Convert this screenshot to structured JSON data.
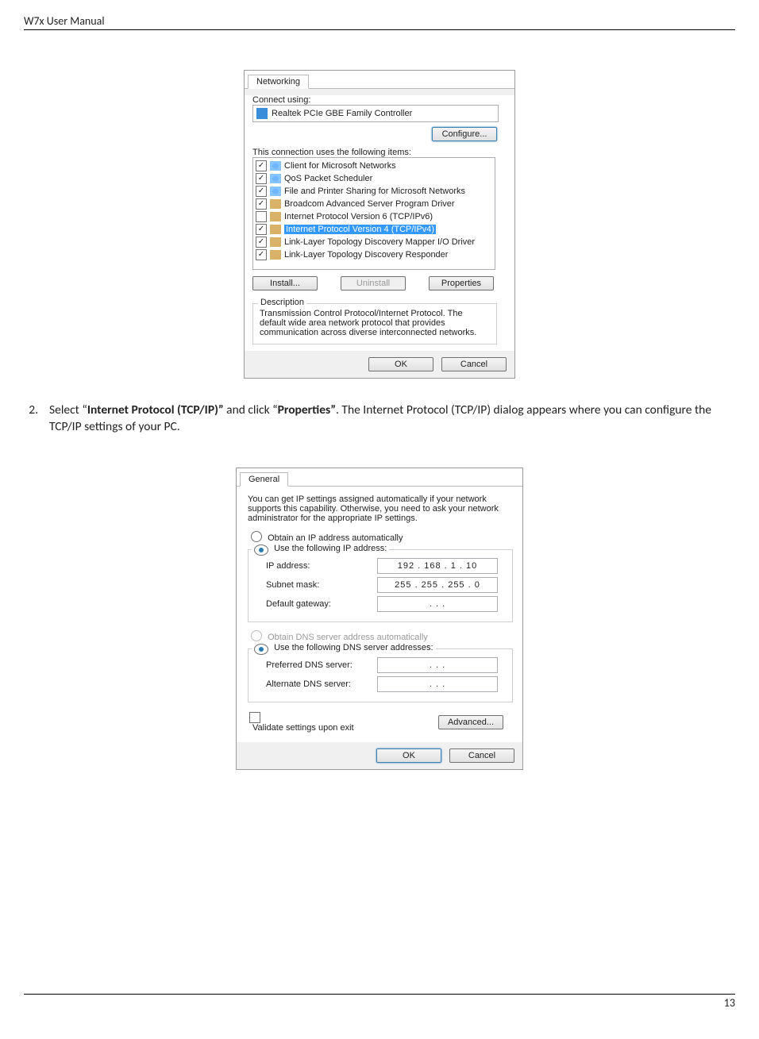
{
  "header": {
    "title": "W7x User Manual"
  },
  "footer": {
    "page_number": "13"
  },
  "figure1": {
    "tab": "Networking",
    "connect_using_label": "Connect using:",
    "adapter": "Realtek PCIe GBE Family Controller",
    "configure_btn": "Configure...",
    "uses_label": "This connection uses the following items:",
    "items": [
      {
        "checked": true,
        "icon": 1,
        "text": "Client for Microsoft Networks",
        "selected": false
      },
      {
        "checked": true,
        "icon": 1,
        "text": "QoS Packet Scheduler",
        "selected": false
      },
      {
        "checked": true,
        "icon": 1,
        "text": "File and Printer Sharing for Microsoft Networks",
        "selected": false
      },
      {
        "checked": true,
        "icon": 3,
        "text": "Broadcom Advanced Server Program Driver",
        "selected": false
      },
      {
        "checked": false,
        "icon": 3,
        "text": "Internet Protocol Version 6 (TCP/IPv6)",
        "selected": false
      },
      {
        "checked": true,
        "icon": 3,
        "text": "Internet Protocol Version 4 (TCP/IPv4)",
        "selected": true
      },
      {
        "checked": true,
        "icon": 3,
        "text": "Link-Layer Topology Discovery Mapper I/O Driver",
        "selected": false
      },
      {
        "checked": true,
        "icon": 3,
        "text": "Link-Layer Topology Discovery Responder",
        "selected": false
      }
    ],
    "install_btn": "Install...",
    "uninstall_btn": "Uninstall",
    "properties_btn": "Properties",
    "desc_title": "Description",
    "desc_text": "Transmission Control Protocol/Internet Protocol. The default wide area network protocol that provides communication across diverse interconnected networks.",
    "ok_btn": "OK",
    "cancel_btn": "Cancel"
  },
  "step2": {
    "num": "2.",
    "pre1": "Select “",
    "bold1": "Internet Protocol (TCP/IP)”",
    "mid1": " and click “",
    "bold2": "Properties”",
    "post": ".  The Internet Protocol (TCP/IP) dialog appears where you can configure the TCP/IP settings of your PC."
  },
  "figure2": {
    "tab": "General",
    "intro": "You can get IP settings assigned automatically if your network supports this capability. Otherwise, you need to ask your network administrator for the appropriate IP settings.",
    "r_auto_ip": "Obtain an IP address automatically",
    "r_use_ip": "Use the following IP address:",
    "ip_label": "IP address:",
    "ip_value": "192 . 168 .   1   .  10",
    "mask_label": "Subnet mask:",
    "mask_value": "255 . 255 . 255 .   0",
    "gw_label": "Default gateway:",
    "gw_value": ".       .       .",
    "r_auto_dns": "Obtain DNS server address automatically",
    "r_use_dns": "Use the following DNS server addresses:",
    "pdns_label": "Preferred DNS server:",
    "pdns_value": ".       .       .",
    "adns_label": "Alternate DNS server:",
    "adns_value": ".       .       .",
    "validate_label": "Validate settings upon exit",
    "advanced_btn": "Advanced...",
    "ok_btn": "OK",
    "cancel_btn": "Cancel"
  }
}
